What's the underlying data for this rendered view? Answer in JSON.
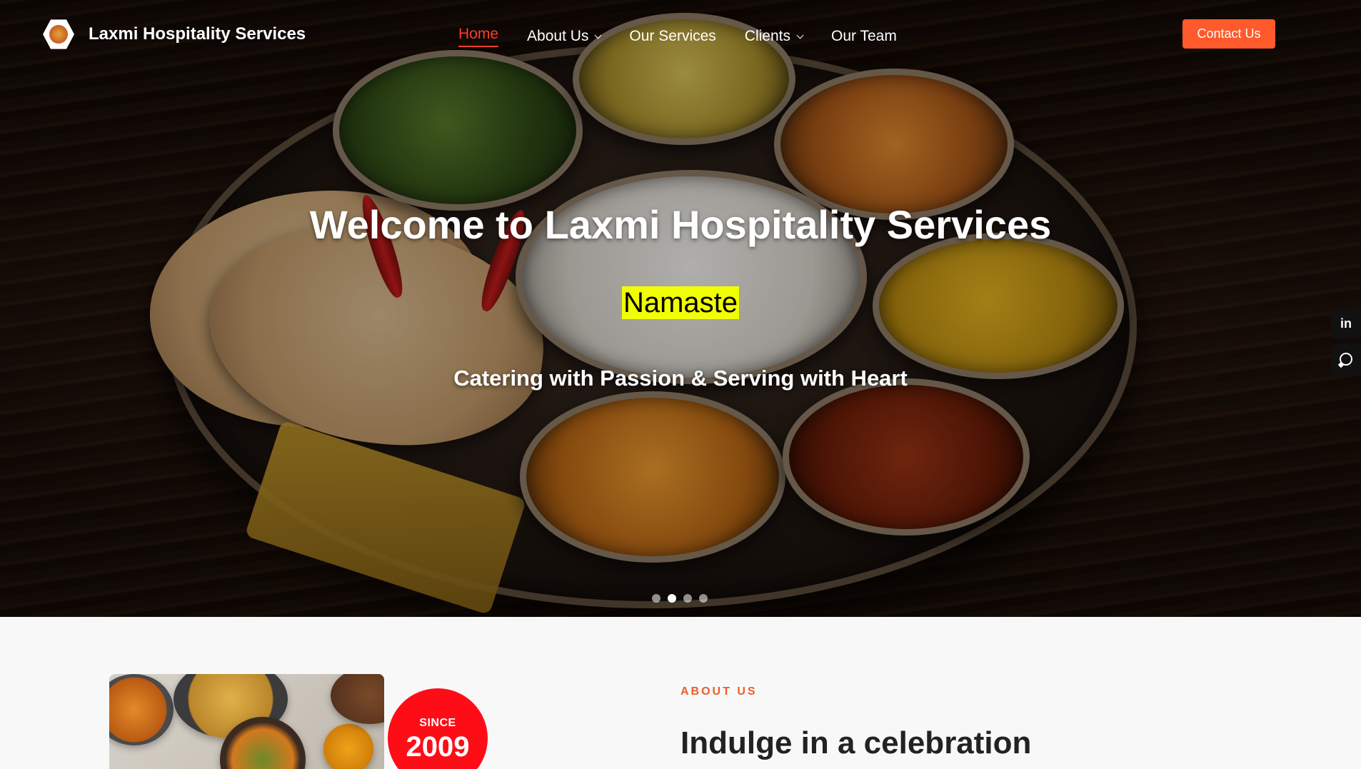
{
  "header": {
    "brand": "Laxmi Hospitality Services",
    "nav": [
      {
        "label": "Home",
        "active": true,
        "dropdown": false
      },
      {
        "label": "About Us",
        "active": false,
        "dropdown": true
      },
      {
        "label": "Our Services",
        "active": false,
        "dropdown": false
      },
      {
        "label": "Clients",
        "active": false,
        "dropdown": true
      },
      {
        "label": "Our Team",
        "active": false,
        "dropdown": false
      }
    ],
    "contact_label": "Contact Us"
  },
  "hero": {
    "title": "Welcome to Laxmi Hospitality Services",
    "greeting": "Namaste",
    "tagline": "Catering with Passion & Serving with Heart",
    "slide_count": 4,
    "active_slide": 2
  },
  "social": {
    "linkedin_label": "in"
  },
  "about": {
    "since_label": "SINCE",
    "since_year": "2009",
    "kicker": "ABOUT US",
    "heading": "Indulge in a celebration"
  },
  "colors": {
    "accent": "#fe5a2b",
    "nav_active": "#ff3b2f",
    "highlight": "#f2ff00",
    "badge": "#ff0d17"
  }
}
